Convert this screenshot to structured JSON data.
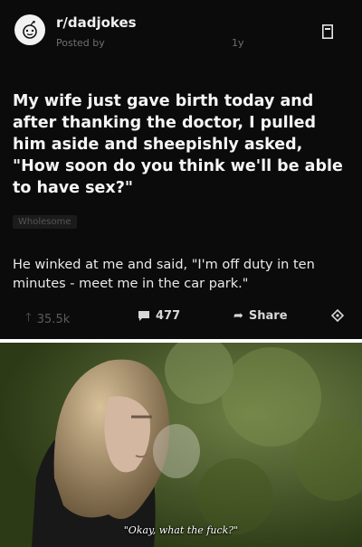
{
  "post": {
    "subreddit": "r/dadjokes",
    "posted_by": "Posted by",
    "age": "1y",
    "title": "My wife just gave birth today and after thanking the doctor, I pulled him aside and sheepishly asked, \"How soon do you think we'll be able to have sex?\"",
    "flair": "Wholesome",
    "body": "He winked at me and said, \"I'm off duty in ten minutes - meet me in the car park.\"",
    "upvotes": "35.5k",
    "comments": "477",
    "share_label": "Share"
  },
  "reaction": {
    "caption": "\"Okay, what the fuck?\""
  },
  "icons": {
    "avatar": "reddit-snoo-icon",
    "save": "bookmark-icon",
    "upvote": "upvote-arrow-icon",
    "comment": "comment-bubble-icon",
    "share": "share-arrow-icon",
    "award": "award-icon"
  }
}
